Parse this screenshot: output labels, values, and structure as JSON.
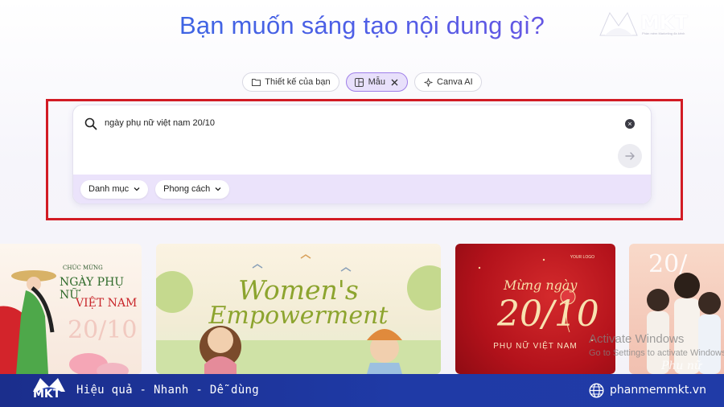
{
  "header": {
    "headline": "Bạn muốn sáng tạo nội dung gì?",
    "logo": {
      "text": "MKT",
      "tagline": "Phần mềm Marketing đa kênh"
    }
  },
  "tabs": [
    {
      "label": "Thiết kế của bạn",
      "icon": "folder-icon",
      "active": false
    },
    {
      "label": "Mẫu",
      "icon": "template-icon",
      "active": true
    },
    {
      "label": "Canva AI",
      "icon": "sparkle-icon",
      "active": false
    }
  ],
  "search": {
    "value": "ngày phụ nữ việt nam 20/10",
    "clear_icon": "close-icon",
    "submit_icon": "arrow-right-icon"
  },
  "filters": [
    {
      "label": "Danh mục"
    },
    {
      "label": "Phong cách"
    }
  ],
  "thumbnails": [
    {
      "lines": [
        "CHÚC MỪNG",
        "NGÀY PHỤ NỮ",
        "VIỆT NAM",
        "20/10"
      ]
    },
    {
      "lines": [
        "Women's",
        "Empowerment"
      ]
    },
    {
      "lines": [
        "Mừng ngày",
        "20/10",
        "PHỤ NỮ VIỆT NAM",
        "YOUR LOGO"
      ]
    },
    {
      "lines": [
        "20/",
        "Phụ nữ"
      ]
    }
  ],
  "overlay": {
    "activate_title": "Activate Windows",
    "activate_sub": "Go to Settings to activate Windows."
  },
  "footer": {
    "logo_text": "MKT",
    "slogan": "Hiệu quả - Nhanh - Dễ dùng",
    "website": "phanmemmkt.vn"
  },
  "colors": {
    "accent_purple": "#9f7fe9",
    "highlight_red": "#d21b24",
    "footer_blue": "#1f3aa6",
    "filter_bar": "#ebe3fb"
  }
}
